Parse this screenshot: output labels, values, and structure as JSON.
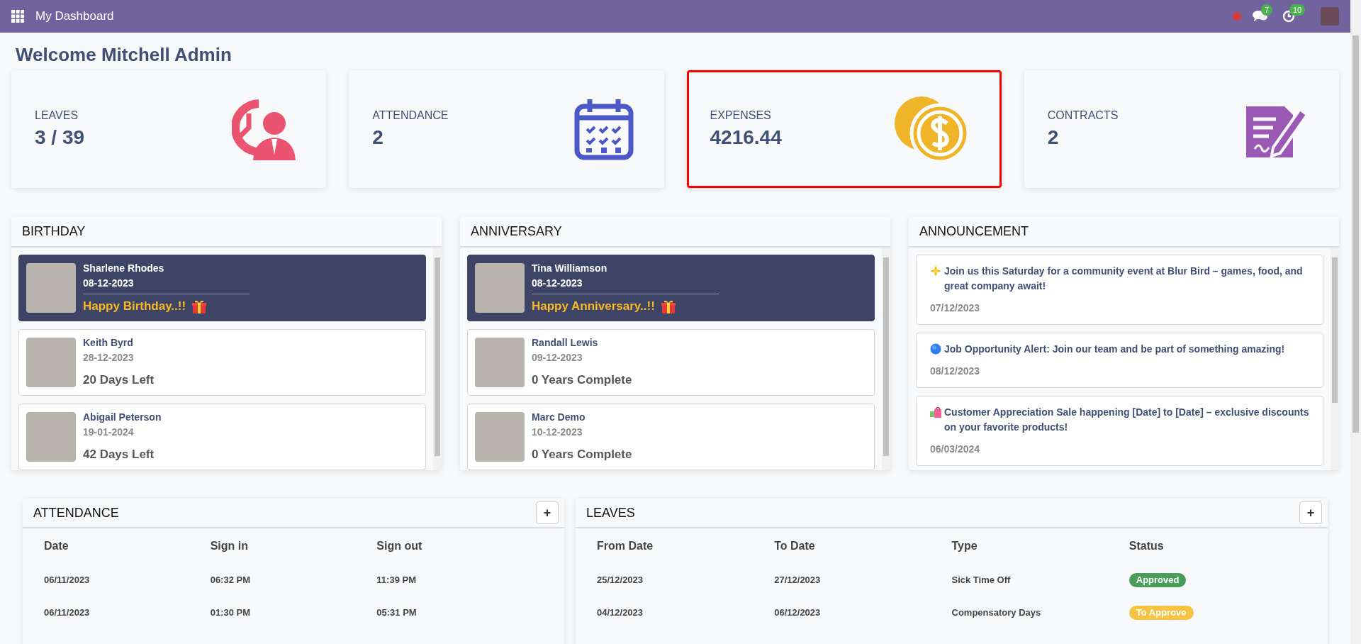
{
  "topbar": {
    "title": "My Dashboard",
    "messages_count": "7",
    "activities_count": "10"
  },
  "welcome": "Welcome Mitchell Admin",
  "stats": [
    {
      "label": "LEAVES",
      "value": "3 / 39",
      "kind": "leaves",
      "selected": false
    },
    {
      "label": "ATTENDANCE",
      "value": "2",
      "kind": "attendance",
      "selected": false
    },
    {
      "label": "EXPENSES",
      "value": "4216.44",
      "kind": "expenses",
      "selected": true
    },
    {
      "label": "CONTRACTS",
      "value": "2",
      "kind": "contracts",
      "selected": false
    }
  ],
  "birthday": {
    "title": "BIRTHDAY",
    "items": [
      {
        "name": "Sharlene Rhodes",
        "date": "08-12-2023",
        "note": "Happy Birthday..!!",
        "today": true
      },
      {
        "name": "Keith Byrd",
        "date": "28-12-2023",
        "note": "20 Days Left",
        "today": false
      },
      {
        "name": "Abigail Peterson",
        "date": "19-01-2024",
        "note": "42 Days Left",
        "today": false
      }
    ]
  },
  "anniversary": {
    "title": "ANNIVERSARY",
    "items": [
      {
        "name": "Tina Williamson",
        "date": "08-12-2023",
        "note": "Happy Anniversary..!!",
        "today": true
      },
      {
        "name": "Randall Lewis",
        "date": "09-12-2023",
        "note": "0 Years Complete",
        "today": false
      },
      {
        "name": "Marc Demo",
        "date": "10-12-2023",
        "note": "0 Years Complete",
        "today": false
      }
    ]
  },
  "announcement": {
    "title": "ANNOUNCEMENT",
    "items": [
      {
        "kind": "star",
        "text": "Join us this Saturday for a community event at Blur Bird – games, food, and great company await!",
        "date": "07/12/2023"
      },
      {
        "kind": "globe",
        "text": "Job Opportunity Alert: Join our team and be part of something amazing!",
        "date": "08/12/2023"
      },
      {
        "kind": "bag",
        "text": "Customer Appreciation Sale happening [Date] to [Date] – exclusive discounts on your favorite products!",
        "date": "06/03/2024"
      }
    ]
  },
  "attendance_table": {
    "title": "ATTENDANCE",
    "add": "+",
    "columns": [
      "Date",
      "Sign in",
      "Sign out"
    ],
    "rows": [
      [
        "06/11/2023",
        "06:32 PM",
        "11:39 PM"
      ],
      [
        "06/11/2023",
        "01:30 PM",
        "05:31 PM"
      ]
    ]
  },
  "leaves_table": {
    "title": "LEAVES",
    "add": "+",
    "columns": [
      "From Date",
      "To Date",
      "Type",
      "Status"
    ],
    "rows": [
      {
        "from": "25/12/2023",
        "to": "27/12/2023",
        "type": "Sick Time Off",
        "status": "Approved",
        "color": "#4a9d5b"
      },
      {
        "from": "04/12/2023",
        "to": "06/12/2023",
        "type": "Compensatory Days",
        "status": "To Approve",
        "color": "#f6c342"
      }
    ]
  }
}
